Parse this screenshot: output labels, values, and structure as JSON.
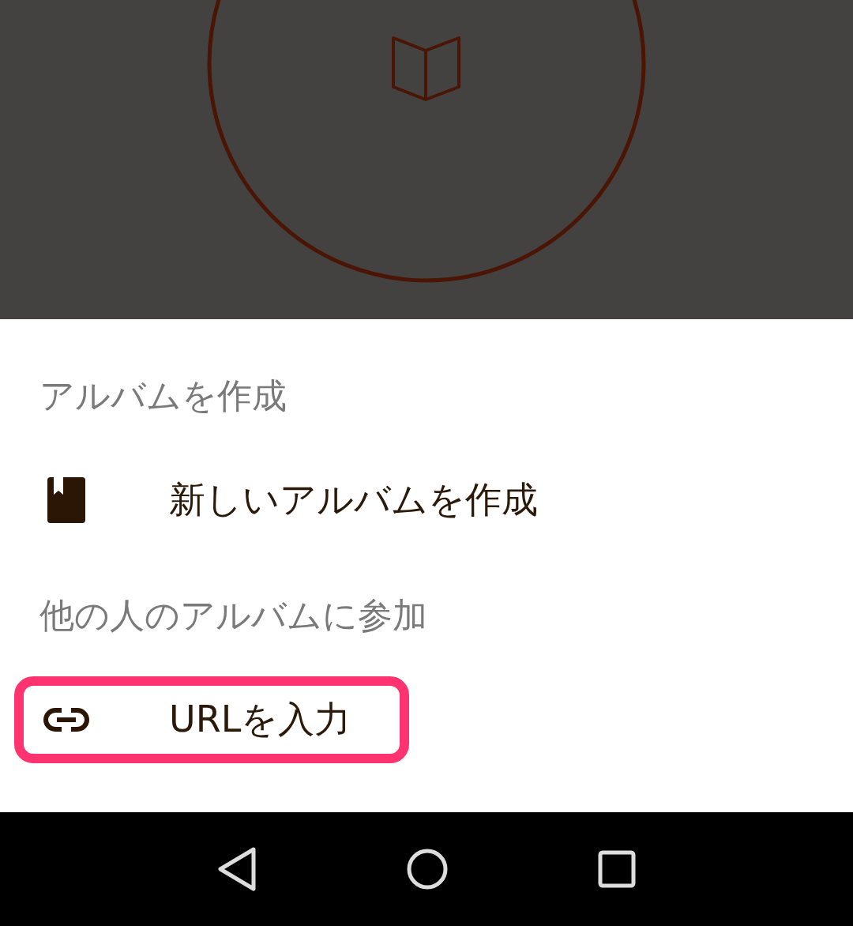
{
  "sections": [
    {
      "header": "アルバムを作成",
      "items": [
        {
          "kind": "album",
          "label": "新しいアルバムを作成",
          "highlighted": false
        }
      ]
    },
    {
      "header": "他の人のアルバムに参加",
      "items": [
        {
          "kind": "link",
          "label": "URLを入力",
          "highlighted": true
        }
      ]
    }
  ]
}
